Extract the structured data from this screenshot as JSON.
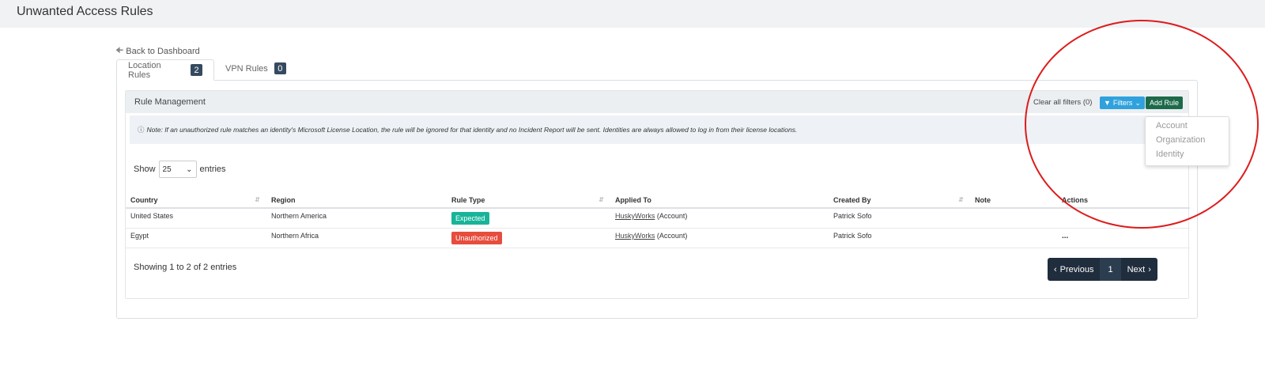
{
  "header": {
    "title": "Unwanted Access Rules"
  },
  "nav": {
    "back_label": "Back to Dashboard"
  },
  "tabs": [
    {
      "label": "Location Rules",
      "count": "2"
    },
    {
      "label": "VPN Rules",
      "count": "0"
    }
  ],
  "card": {
    "title": "Rule Management",
    "clear_filters": "Clear all filters (0)",
    "filters_label": "Filters",
    "add_rule_label": "Add Rule",
    "note": "Note: If an unauthorized rule matches an identity's Microsoft License Location, the rule will be ignored for that identity and no Incident Report will be sent. Identities are always allowed to log in from their license locations."
  },
  "table_controls": {
    "show_label": "Show",
    "entries_value": "25",
    "entries_label": "entries"
  },
  "table": {
    "columns": [
      "Country",
      "Region",
      "Rule Type",
      "Applied To",
      "Created By",
      "Note",
      "Actions"
    ],
    "rows": [
      {
        "country": "United States",
        "region": "Northern America",
        "rule_type": "Expected",
        "applied_to_link": "HuskyWorks",
        "applied_to_suffix": "(Account)",
        "created_by": "Patrick Sofo",
        "note": "",
        "actions": ""
      },
      {
        "country": "Egypt",
        "region": "Northern Africa",
        "rule_type": "Unauthorized",
        "applied_to_link": "HuskyWorks",
        "applied_to_suffix": "(Account)",
        "created_by": "Patrick Sofo",
        "note": "",
        "actions": "..."
      }
    ]
  },
  "footer": {
    "showing": "Showing 1 to 2 of 2 entries"
  },
  "pagination": {
    "previous": "Previous",
    "page": "1",
    "next": "Next"
  },
  "filters_dropdown": {
    "items": [
      "Account",
      "Organization",
      "Identity"
    ]
  },
  "colors": {
    "expected": "#18b49a",
    "unauthorized": "#e74c3c",
    "filters_button": "#2fa2dd",
    "add_rule_button": "#1c6a4a",
    "pager": "#1f2d3d",
    "annotation": "#dd1c1c"
  }
}
